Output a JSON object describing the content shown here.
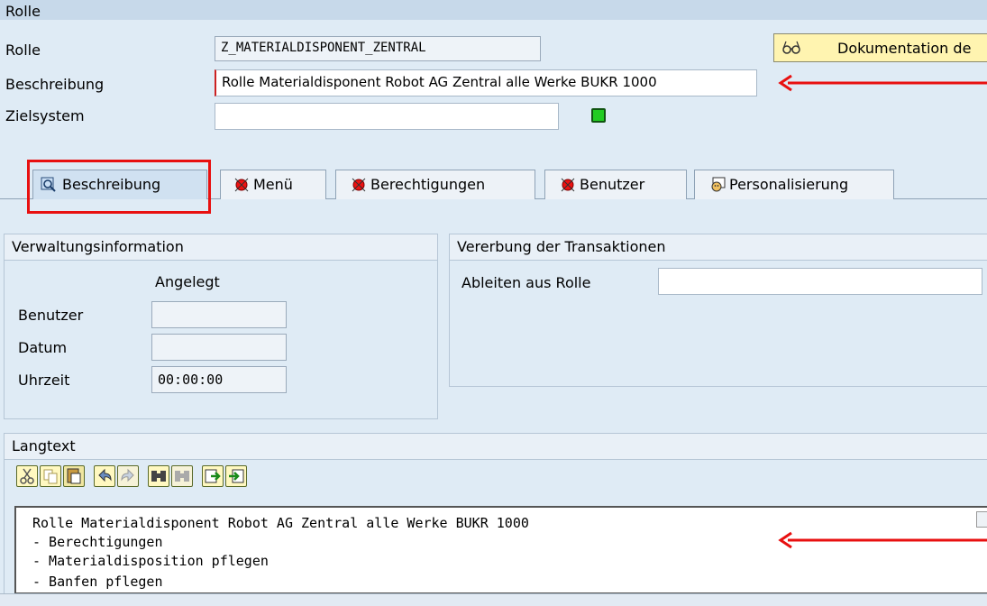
{
  "header": {
    "title": "Rolle"
  },
  "form": {
    "rolle_label": "Rolle",
    "rolle_value": "Z_MATERIALDISPONENT_ZENTRAL",
    "beschreibung_label": "Beschreibung",
    "beschreibung_value": "Rolle Materialdisponent Robot AG Zentral alle Werke BUKR 1000",
    "zielsystem_label": "Zielsystem",
    "zielsystem_value": "",
    "doc_button_label": "Dokumentation de"
  },
  "tabs": [
    {
      "label": "Beschreibung",
      "icon": "magnifier-icon",
      "active": true
    },
    {
      "label": "Menü",
      "icon": "red-status-icon"
    },
    {
      "label": "Berechtigungen",
      "icon": "red-status-icon"
    },
    {
      "label": "Benutzer",
      "icon": "red-status-icon"
    },
    {
      "label": "Personalisierung",
      "icon": "personalization-icon"
    }
  ],
  "verwaltung": {
    "title": "Verwaltungsinformation",
    "column_header": "Angelegt",
    "benutzer_label": "Benutzer",
    "benutzer_value": "",
    "datum_label": "Datum",
    "datum_value": "",
    "uhrzeit_label": "Uhrzeit",
    "uhrzeit_value": "00:00:00"
  },
  "vererbung": {
    "title": "Vererbung der Transaktionen",
    "ableiten_label": "Ableiten aus Rolle",
    "ableiten_value": ""
  },
  "langtext": {
    "title": "Langtext",
    "toolbar": [
      "cut-icon",
      "copy-icon",
      "paste-icon",
      "undo-icon",
      "redo-icon",
      "find-icon",
      "find-next-icon",
      "import-icon",
      "export-icon"
    ],
    "lines": [
      "Rolle Materialdisponent Robot AG Zentral alle Werke BUKR 1000",
      "- Berechtigungen",
      "- Materialdisposition pflegen",
      "- Banfen pflegen"
    ]
  },
  "colors": {
    "accent_red": "#e81010",
    "status_green": "#22cc22",
    "background": "#dfebf5"
  }
}
